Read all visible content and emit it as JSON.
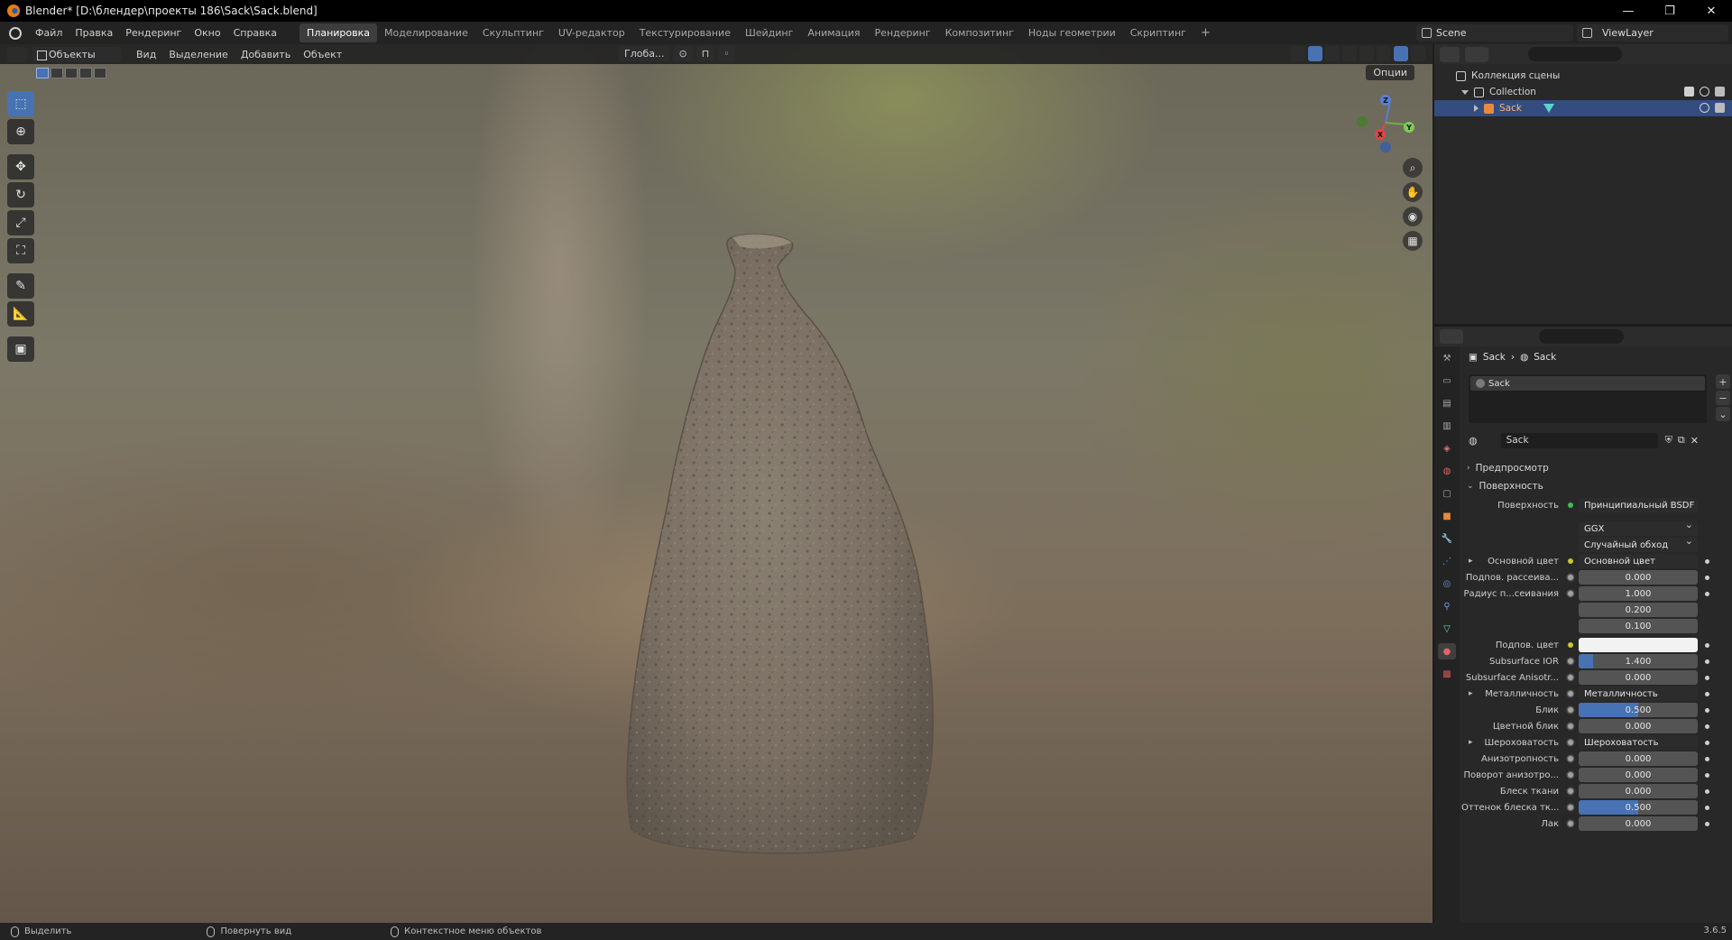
{
  "window": {
    "title": "Blender* [D:\\блендер\\проекты 186\\Sack\\Sack.blend]",
    "controls": [
      "—",
      "❐",
      "✕"
    ]
  },
  "menu": {
    "items": [
      "Файл",
      "Правка",
      "Рендеринг",
      "Окно",
      "Справка"
    ],
    "workspaces": [
      "Планировка",
      "Моделирование",
      "Скульптинг",
      "UV-редактор",
      "Текстурирование",
      "Шейдинг",
      "Анимация",
      "Рендеринг",
      "Композитинг",
      "Ноды геометрии",
      "Скриптинг"
    ],
    "active_workspace": "Планировка",
    "add": "+",
    "scene": "Scene",
    "view_layer": "ViewLayer"
  },
  "viewport": {
    "mode": "Объекты",
    "menus": [
      "Вид",
      "Выделение",
      "Добавить",
      "Объект"
    ],
    "orientation": "Глоба...",
    "options": "Опции",
    "gizmo": {
      "z": "Z",
      "y": "Y",
      "x": "X"
    }
  },
  "outliner": {
    "scene_collection": "Коллекция сцены",
    "collection": "Collection",
    "object": "Sack"
  },
  "properties": {
    "breadcrumb": [
      "Sack",
      "Sack"
    ],
    "slot": "Sack",
    "material_name": "Sack",
    "panels": {
      "preview": "Предпросмотр",
      "surface": "Поверхность"
    },
    "surface_label": "Поверхность",
    "surface_value": "Принципиальный BSDF",
    "distribution": "GGX",
    "subsurface_method": "Случайный обход",
    "rows": [
      {
        "label": "Основной цвет",
        "type": "link",
        "value": "Основной цвет",
        "dot": "y",
        "expand": true
      },
      {
        "label": "Подпов. рассеива...",
        "type": "num",
        "value": "0.000",
        "dot": "g",
        "fill": 0
      },
      {
        "label": "Радиус п...сеивания",
        "type": "num",
        "value": "1.000",
        "dot": "g",
        "fill": 0
      },
      {
        "label": "",
        "type": "num",
        "value": "0.200",
        "dot": "",
        "fill": 0
      },
      {
        "label": "",
        "type": "num",
        "value": "0.100",
        "dot": "",
        "fill": 0
      },
      {
        "label": "Подпов. цвет",
        "type": "color",
        "value": "",
        "dot": "y"
      },
      {
        "label": "Subsurface IOR",
        "type": "num",
        "value": "1.400",
        "dot": "g",
        "fill": 0.12
      },
      {
        "label": "Subsurface Anisotr...",
        "type": "num",
        "value": "0.000",
        "dot": "g",
        "fill": 0
      },
      {
        "label": "Металличность",
        "type": "link",
        "value": "Металличность",
        "dot": "g",
        "expand": true
      },
      {
        "label": "Блик",
        "type": "num",
        "value": "0.500",
        "dot": "g",
        "fill": 0.5
      },
      {
        "label": "Цветной блик",
        "type": "num",
        "value": "0.000",
        "dot": "g",
        "fill": 0
      },
      {
        "label": "Шероховатость",
        "type": "link",
        "value": "Шероховатость",
        "dot": "g",
        "expand": true
      },
      {
        "label": "Анизотропность",
        "type": "num",
        "value": "0.000",
        "dot": "g",
        "fill": 0
      },
      {
        "label": "Поворот анизотро...",
        "type": "num",
        "value": "0.000",
        "dot": "g",
        "fill": 0
      },
      {
        "label": "Блеск ткани",
        "type": "num",
        "value": "0.000",
        "dot": "g",
        "fill": 0
      },
      {
        "label": "Оттенок блеска тк...",
        "type": "num",
        "value": "0.500",
        "dot": "g",
        "fill": 0.5
      },
      {
        "label": "Лак",
        "type": "num",
        "value": "0.000",
        "dot": "g",
        "fill": 0
      }
    ]
  },
  "status": {
    "select": "Выделить",
    "rotate": "Повернуть вид",
    "context": "Контекстное меню объектов",
    "version": "3.6.5"
  },
  "colors": {
    "accent": "#4772b3",
    "selection": "#334d80",
    "yellow_socket": "#c7c729"
  }
}
